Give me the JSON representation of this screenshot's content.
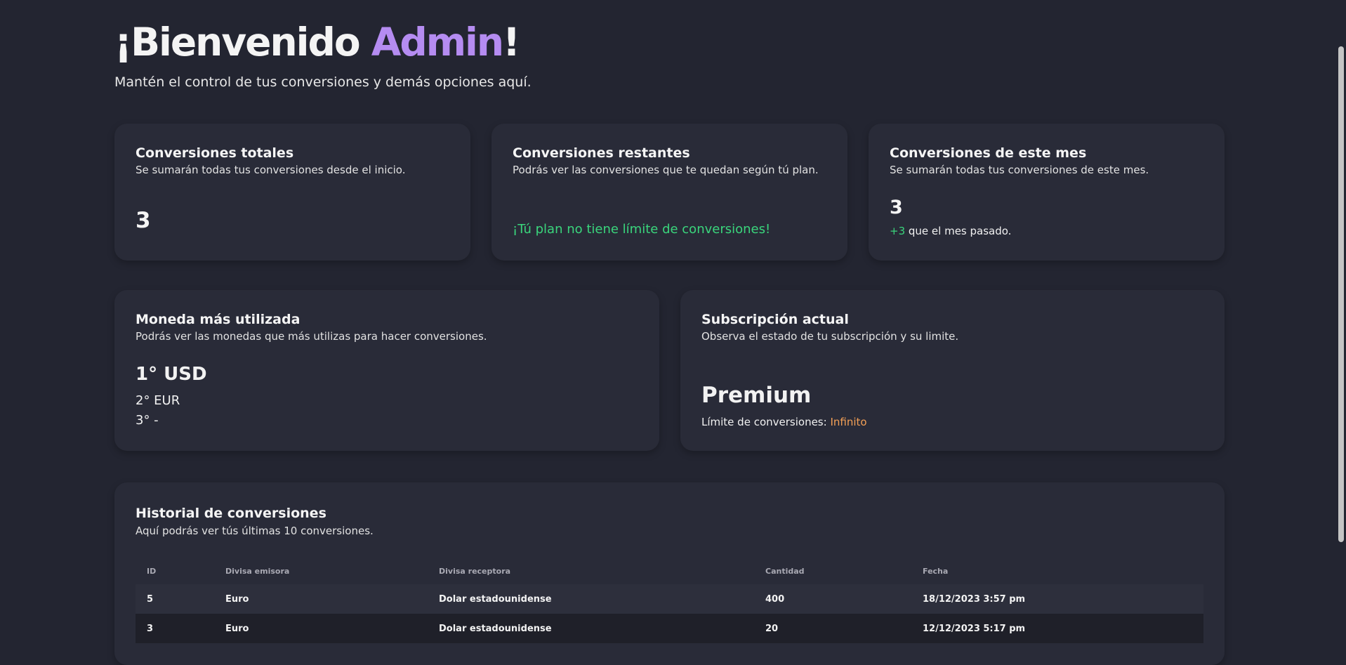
{
  "header": {
    "greeting_prefix": "¡Bienvenido ",
    "user_name": "Admin",
    "greeting_suffix": "!",
    "subtitle": "Mantén el control de tus conversiones y demás opciones aquí."
  },
  "stats": {
    "total": {
      "title": "Conversiones totales",
      "description": "Se sumarán todas tus conversiones desde el inicio.",
      "value": "3"
    },
    "remaining": {
      "title": "Conversiones restantes",
      "description": "Podrás ver las conversiones que te quedan según tú plan.",
      "message": "¡Tú plan no tiene límite de conversiones!"
    },
    "month": {
      "title": "Conversiones de este mes",
      "description": "Se sumarán todas tus conversiones de este mes.",
      "value": "3",
      "delta": "+3",
      "delta_text": " que el mes pasado."
    }
  },
  "currency": {
    "title": "Moneda más utilizada",
    "description": "Podrás ver las monedas que más utilizas para hacer conversiones.",
    "first": "1° USD",
    "second": "2° EUR",
    "third": "3° -"
  },
  "subscription": {
    "title": "Subscripción actual",
    "description": "Observa el estado de tu subscripción y su limite.",
    "plan": "Premium",
    "limit_label": "Límite de conversiones: ",
    "limit_value": "Infinito"
  },
  "history": {
    "title": "Historial de conversiones",
    "description": "Aquí podrás ver tús últimas 10 conversiones.",
    "columns": [
      "ID",
      "Divisa emisora",
      "Divisa receptora",
      "Cantidad",
      "Fecha"
    ],
    "rows": [
      [
        "5",
        "Euro",
        "Dolar estadounidense",
        "400",
        "18/12/2023 3:57 pm"
      ],
      [
        "3",
        "Euro",
        "Dolar estadounidense",
        "20",
        "12/12/2023 5:17 pm"
      ]
    ]
  },
  "colors": {
    "background": "#232531",
    "card": "#292b38",
    "accent": "#b58cf1",
    "positive": "#3ad57c",
    "highlight": "#f4a056"
  }
}
